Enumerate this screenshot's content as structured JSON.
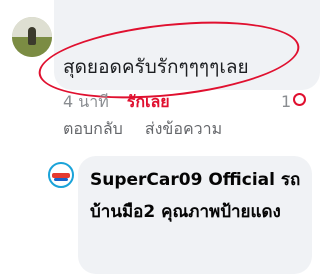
{
  "comment": {
    "text": "สุดยอดครับรักๆๆๆๆเลย",
    "time": "4 นาที",
    "reaction_label": "รักเลย",
    "reaction_count": "1",
    "actions": {
      "reply": "ตอบกลับ",
      "send_message": "ส่งข้อความ"
    }
  },
  "reply": {
    "text": "SuperCar09 Official รถบ้านมือ2 คุณภาพป้ายแดง"
  },
  "colors": {
    "highlight": "#e0102f",
    "bubble": "#f0f2f5",
    "meta_text": "#65676b"
  }
}
